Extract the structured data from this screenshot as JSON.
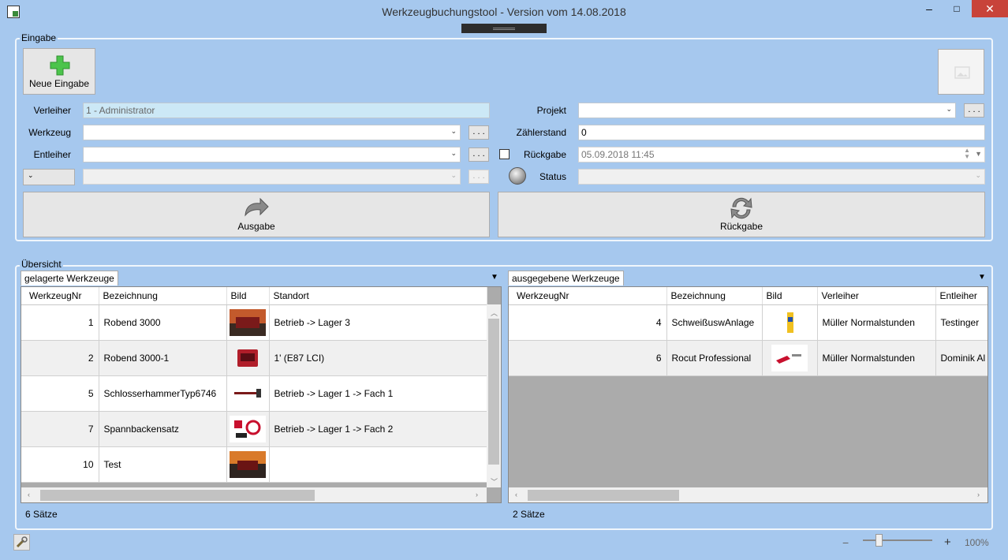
{
  "window": {
    "title": "Werkzeugbuchungstool - Version vom 14.08.2018",
    "minimize": "–",
    "maximize": "□",
    "close": "✕"
  },
  "eingabe": {
    "group_label": "Eingabe",
    "new_button": "Neue Eingabe",
    "verleiher_label": "Verleiher",
    "verleiher_value": "1 - Administrator",
    "werkzeug_label": "Werkzeug",
    "werkzeug_value": "",
    "entleiher_label": "Entleiher",
    "entleiher_value": "",
    "small_select_value": "",
    "dots": ". . .",
    "projekt_label": "Projekt",
    "projekt_value": "",
    "zaehlerstand_label": "Zählerstand",
    "zaehlerstand_value": "0",
    "rueckgabe_label": "Rückgabe",
    "rueckgabe_value": "05.09.2018 11:45",
    "status_label": "Status",
    "status_value": "",
    "ausgabe_button": "Ausgabe",
    "rueckgabe_button": "Rückgabe"
  },
  "uebersicht": {
    "group_label": "Übersicht",
    "left": {
      "tab": "gelagerte Werkzeuge",
      "columns": [
        "WerkzeugNr",
        "Bezeichnung",
        "Bild",
        "Standort"
      ],
      "rows": [
        {
          "nr": "1",
          "bez": "Robend 3000",
          "standort": "Betrieb -> Lager 3"
        },
        {
          "nr": "2",
          "bez": "Robend 3000-1",
          "standort": "1' (E87 LCI)"
        },
        {
          "nr": "5",
          "bez": "SchlosserhammerTyp6746",
          "standort": "Betrieb -> Lager 1 -> Fach 1"
        },
        {
          "nr": "7",
          "bez": "Spannbackensatz",
          "standort": "Betrieb -> Lager 1 -> Fach 2"
        },
        {
          "nr": "10",
          "bez": "Test",
          "standort": ""
        }
      ],
      "count": "6 Sätze"
    },
    "right": {
      "tab": "ausgegebene Werkzeuge",
      "columns": [
        "WerkzeugNr",
        "Bezeichnung",
        "Bild",
        "Verleiher",
        "Entleiher"
      ],
      "rows": [
        {
          "nr": "4",
          "bez": "SchweißuswAnlage",
          "verleiher": "Müller Normalstunden",
          "entleiher": "Testinger"
        },
        {
          "nr": "6",
          "bez": "Rocut Professional",
          "verleiher": "Müller Normalstunden",
          "entleiher": "Dominik Al"
        }
      ],
      "count": "2 Sätze"
    }
  },
  "status_bar": {
    "zoom_minus": "−",
    "zoom_plus": "+",
    "zoom_level": "100%"
  }
}
